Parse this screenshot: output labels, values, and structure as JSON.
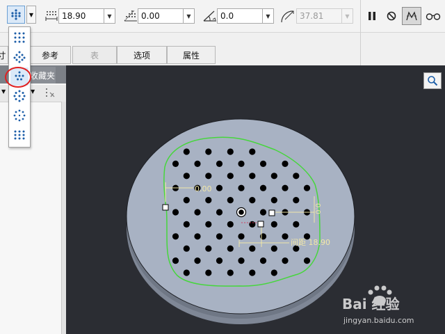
{
  "toolbar": {
    "spacing_value": "18.90",
    "angle_value": "0.00",
    "rotation_value": "0.0",
    "radius_value": "37.81"
  },
  "tabs": [
    {
      "label": "寸"
    },
    {
      "label": "参考"
    },
    {
      "label": "表"
    },
    {
      "label": "选项"
    },
    {
      "label": "属性"
    }
  ],
  "panel": {
    "folder_tab": "收藏夹"
  },
  "canvas": {
    "angle_annotation": "0.00",
    "spacing_annotation": "间距 18.90",
    "vertical_annotation": "0.0"
  },
  "watermark": {
    "brand": "Bai 经验",
    "url": "jingyan.baidu.com"
  },
  "colors": {
    "viewport_bg": "#2b2d33",
    "disk_top": "#a8b2c3",
    "disk_side": "#7f8796",
    "boundary": "#46d63c",
    "annotation": "#f1e7a8",
    "highlight_circle": "#e02020",
    "icon_blue": "#1c5ea8"
  }
}
